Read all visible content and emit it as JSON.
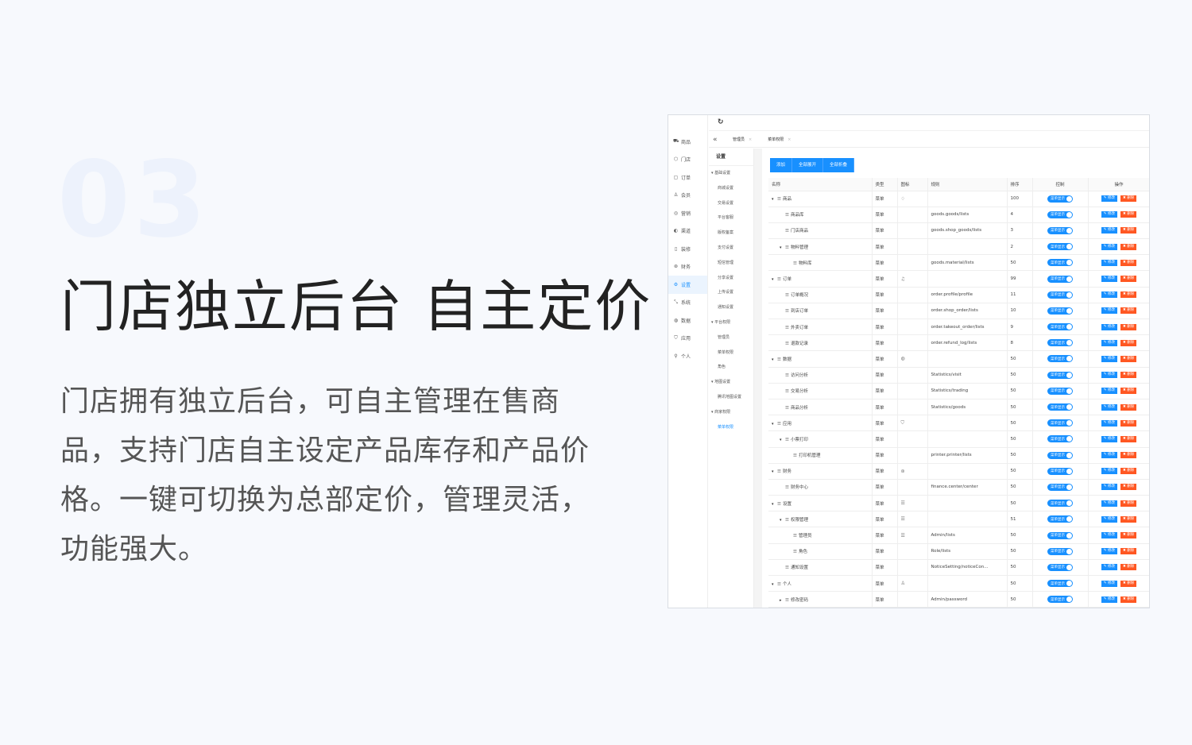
{
  "hero": {
    "number": "03",
    "title": "门店独立后台 自主定价",
    "description": "门店拥有独立后台，可自主管理在售商品，支持门店自主设定产品库存和产品价格。一键可切换为总部定价，管理灵活，功能强大。"
  },
  "admin": {
    "nav_primary": [
      {
        "label": "商品",
        "icon": "cart-icon",
        "glyph": "⛟"
      },
      {
        "label": "门店",
        "icon": "store-icon",
        "glyph": "⬡"
      },
      {
        "label": "订单",
        "icon": "order-icon",
        "glyph": "▢"
      },
      {
        "label": "会员",
        "icon": "user-icon",
        "glyph": "♙"
      },
      {
        "label": "营销",
        "icon": "marketing-icon",
        "glyph": "◎"
      },
      {
        "label": "渠道",
        "icon": "channel-icon",
        "glyph": "◐"
      },
      {
        "label": "装修",
        "icon": "decor-icon",
        "glyph": "▯"
      },
      {
        "label": "财务",
        "icon": "finance-icon",
        "glyph": "⊛"
      },
      {
        "label": "设置",
        "icon": "settings-icon",
        "glyph": "⚙",
        "active": true
      },
      {
        "label": "系统",
        "icon": "system-icon",
        "glyph": "⤡"
      },
      {
        "label": "数据",
        "icon": "data-icon",
        "glyph": "◍"
      },
      {
        "label": "应用",
        "icon": "app-icon",
        "glyph": "⛉"
      },
      {
        "label": "个人",
        "icon": "person-icon",
        "glyph": "⚲"
      }
    ],
    "nav_secondary_title": "设置",
    "nav_secondary": [
      {
        "label": "▾ 基础设置",
        "group": true
      },
      {
        "label": "商城设置"
      },
      {
        "label": "交易设置"
      },
      {
        "label": "平台客服"
      },
      {
        "label": "版权备案"
      },
      {
        "label": "支付设置"
      },
      {
        "label": "短信管理"
      },
      {
        "label": "分享设置"
      },
      {
        "label": "上传设置"
      },
      {
        "label": "通知设置"
      },
      {
        "label": "▾ 平台权限",
        "group": true
      },
      {
        "label": "管理员"
      },
      {
        "label": "菜单权限"
      },
      {
        "label": "角色"
      },
      {
        "label": "▾ 地图设置",
        "group": true
      },
      {
        "label": "腾讯地图设置"
      },
      {
        "label": "▾ 商家权限",
        "group": true
      },
      {
        "label": "菜单权限",
        "active": true
      }
    ],
    "breadcrumb": [
      {
        "label": "管理员",
        "close": "×"
      },
      {
        "label": "菜单权限",
        "close": "×"
      }
    ],
    "toolbar": [
      "添加",
      "全部展开",
      "全部折叠"
    ],
    "columns": [
      "名称",
      "类型",
      "图标",
      "规则",
      "排序",
      "控制",
      "操作"
    ],
    "switch_label": "菜单显示",
    "edit_label": "✎ 修改",
    "delete_label": "✖ 删除",
    "rows": [
      {
        "level": 0,
        "toggle": "▾",
        "name": "商品",
        "type": "菜单",
        "icon": "♢",
        "rule": "",
        "sort": "100"
      },
      {
        "level": 1,
        "toggle": "",
        "name": "商品库",
        "type": "菜单",
        "icon": "",
        "rule": "goods.goods/lists",
        "sort": "4"
      },
      {
        "level": 1,
        "toggle": "",
        "name": "门店商品",
        "type": "菜单",
        "icon": "",
        "rule": "goods.shop_goods/lists",
        "sort": "3"
      },
      {
        "level": 1,
        "toggle": "▾",
        "name": "物料管理",
        "type": "菜单",
        "icon": "",
        "rule": "",
        "sort": "2"
      },
      {
        "level": 2,
        "toggle": "",
        "name": "物料库",
        "type": "菜单",
        "icon": "",
        "rule": "goods.material/lists",
        "sort": "50"
      },
      {
        "level": 0,
        "toggle": "▾",
        "name": "订单",
        "type": "菜单",
        "icon": "♫",
        "rule": "",
        "sort": "99"
      },
      {
        "level": 1,
        "toggle": "",
        "name": "订单概况",
        "type": "菜单",
        "icon": "",
        "rule": "order.profile/profile",
        "sort": "11"
      },
      {
        "level": 1,
        "toggle": "",
        "name": "到店订单",
        "type": "菜单",
        "icon": "",
        "rule": "order.shop_order/lists",
        "sort": "10"
      },
      {
        "level": 1,
        "toggle": "",
        "name": "外卖订单",
        "type": "菜单",
        "icon": "",
        "rule": "order.takeout_order/lists",
        "sort": "9"
      },
      {
        "level": 1,
        "toggle": "",
        "name": "退款记录",
        "type": "菜单",
        "icon": "",
        "rule": "order.refund_log/lists",
        "sort": "8"
      },
      {
        "level": 0,
        "toggle": "▾",
        "name": "数据",
        "type": "菜单",
        "icon": "◍",
        "rule": "",
        "sort": "50"
      },
      {
        "level": 1,
        "toggle": "",
        "name": "访问分析",
        "type": "菜单",
        "icon": "",
        "rule": "Statistics/visit",
        "sort": "50"
      },
      {
        "level": 1,
        "toggle": "",
        "name": "交易分析",
        "type": "菜单",
        "icon": "",
        "rule": "Statistics/trading",
        "sort": "50"
      },
      {
        "level": 1,
        "toggle": "",
        "name": "商品分析",
        "type": "菜单",
        "icon": "",
        "rule": "Statistics/goods",
        "sort": "50"
      },
      {
        "level": 0,
        "toggle": "▾",
        "name": "应用",
        "type": "菜单",
        "icon": "⛉",
        "rule": "",
        "sort": "50"
      },
      {
        "level": 1,
        "toggle": "▾",
        "name": "小票打印",
        "type": "菜单",
        "icon": "",
        "rule": "",
        "sort": "50"
      },
      {
        "level": 2,
        "toggle": "",
        "name": "打印机管理",
        "type": "菜单",
        "icon": "",
        "rule": "printer.printer/lists",
        "sort": "50"
      },
      {
        "level": 0,
        "toggle": "▾",
        "name": "财务",
        "type": "菜单",
        "icon": "⊛",
        "rule": "",
        "sort": "50"
      },
      {
        "level": 1,
        "toggle": "",
        "name": "财务中心",
        "type": "菜单",
        "icon": "",
        "rule": "finance.center/center",
        "sort": "50"
      },
      {
        "level": 0,
        "toggle": "▾",
        "name": "设置",
        "type": "菜单",
        "icon": "☰",
        "rule": "",
        "sort": "50"
      },
      {
        "level": 1,
        "toggle": "▾",
        "name": "权限管理",
        "type": "菜单",
        "icon": "☰",
        "rule": "",
        "sort": "51"
      },
      {
        "level": 2,
        "toggle": "",
        "name": "管理员",
        "type": "菜单",
        "icon": "☰",
        "rule": "Admin/lists",
        "sort": "50"
      },
      {
        "level": 2,
        "toggle": "",
        "name": "角色",
        "type": "菜单",
        "icon": "",
        "rule": "Role/lists",
        "sort": "50"
      },
      {
        "level": 1,
        "toggle": "",
        "name": "通知设置",
        "type": "菜单",
        "icon": "",
        "rule": "NoticeSetting/noticeCon...",
        "sort": "50"
      },
      {
        "level": 0,
        "toggle": "▾",
        "name": "个人",
        "type": "菜单",
        "icon": "♙",
        "rule": "",
        "sort": "50"
      },
      {
        "level": 1,
        "toggle": "▸",
        "name": "修改密码",
        "type": "菜单",
        "icon": "",
        "rule": "Admin/password",
        "sort": "50"
      }
    ]
  }
}
